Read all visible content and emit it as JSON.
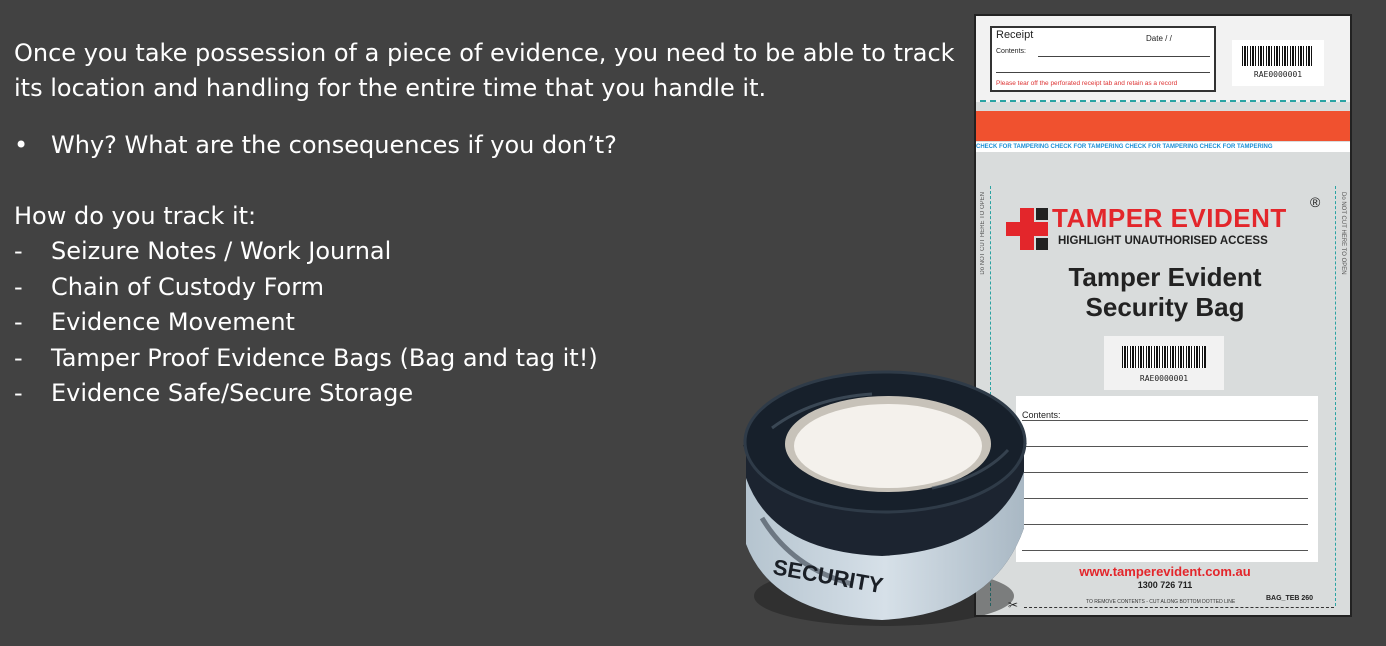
{
  "slide": {
    "intro": "Once you take possession of a piece of evidence, you need to be able to track its location and handling for the entire time that you handle it.",
    "bullets": [
      {
        "marker": "•",
        "text": "Why?  What are the consequences if you don’t?"
      }
    ],
    "track_heading": "How do you track it:",
    "track_items": [
      {
        "marker": "-",
        "text": "Seizure Notes / Work Journal"
      },
      {
        "marker": "-",
        "text": "Chain of Custody Form"
      },
      {
        "marker": "-",
        "text": "Evidence Movement"
      },
      {
        "marker": "-",
        "text": "Tamper Proof Evidence Bags (Bag and tag it!)"
      },
      {
        "marker": "-",
        "text": "Evidence Safe/Secure Storage"
      }
    ]
  },
  "bag": {
    "receipt_title": "Receipt",
    "receipt_date": "Date    /    /",
    "receipt_contents": "Contents:",
    "receipt_note": "Please tear off the perforated receipt tab and retain as a record",
    "barcode_number": "RAE0000001",
    "check_text": "CHECK FOR TAMPERING   CHECK FOR TAMPERING   CHECK FOR TAMPERING   CHECK FOR TAMPERING",
    "side_text": "Do NOT CUT HERE TO OPEN",
    "brand_name": "TAMPER EVIDENT",
    "brand_reg": "®",
    "brand_tagline": "HIGHLIGHT UNAUTHORISED ACCESS",
    "title_line1": "Tamper Evident",
    "title_line2": "Security Bag",
    "contents_label": "Contents:",
    "website": "www.tamperevident.com.au",
    "phone": "1300 726 711",
    "cut_note": "TO REMOVE CONTENTS - CUT ALONG BOTTOM DOTTED LINE",
    "bag_code": "BAG_TEB 260",
    "scissors": "✂"
  },
  "tape": {
    "label": "SECURITY"
  },
  "colors": {
    "background": "#424242",
    "brand_red": "#e3262b",
    "band_orange": "#f0512f",
    "perforation": "#2aa3a3"
  }
}
